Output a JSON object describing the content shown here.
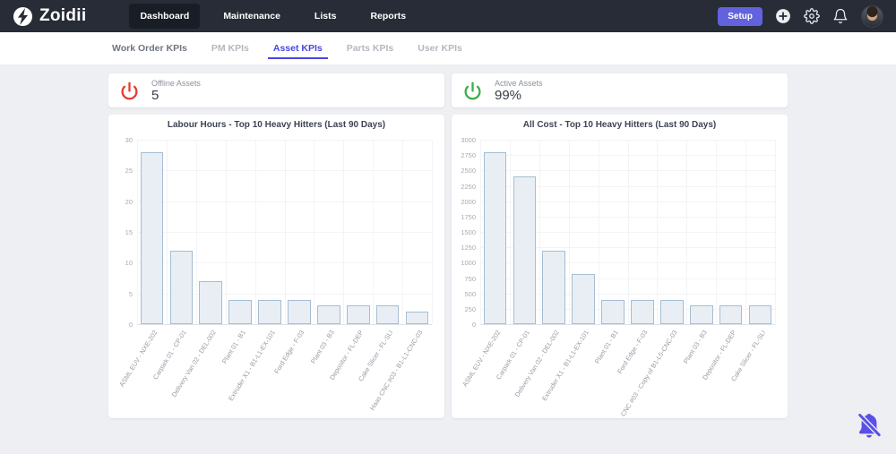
{
  "navbar": {
    "brand": "Zoidii",
    "items": [
      {
        "label": "Dashboard",
        "active": true
      },
      {
        "label": "Maintenance",
        "active": false
      },
      {
        "label": "Lists",
        "active": false
      },
      {
        "label": "Reports",
        "active": false
      }
    ],
    "setup_label": "Setup",
    "icons": {
      "brand": "bolt-circle-icon",
      "add": "plus-circle-icon",
      "settings": "gear-icon",
      "notifications": "bell-icon",
      "avatar": "user-avatar"
    }
  },
  "tabs": [
    {
      "label": "Work Order KPIs",
      "active": false
    },
    {
      "label": "PM KPIs",
      "active": false
    },
    {
      "label": "Asset KPIs",
      "active": true
    },
    {
      "label": "Parts KPIs",
      "active": false
    },
    {
      "label": "User KPIs",
      "active": false
    }
  ],
  "kpis": [
    {
      "label": "Offline Assets",
      "value": "5",
      "icon": "power-icon",
      "color": "#e23b30"
    },
    {
      "label": "Active Assets",
      "value": "99%",
      "icon": "power-icon",
      "color": "#3aae46"
    }
  ],
  "chart_data": [
    {
      "type": "bar",
      "title": "Labour Hours - Top 10 Heavy Hitters (Last 90 Days)",
      "categories": [
        "ASML EUV - NXE-202",
        "Carpark 01 - CP-01",
        "Delivery Van 02 - DEL-002",
        "Plant 01 - B1",
        "Extruder X1 - B1-L1-EX-101",
        "Ford Edge - F-03",
        "Plant 03 - B3",
        "Depositor - FL-DEP",
        "Cake Slicer - FL-SLI",
        "Haas CNC #03 - B1-L1-CNC-03"
      ],
      "values": [
        28,
        12,
        7,
        4,
        4,
        4,
        3,
        3,
        3,
        2
      ],
      "xlabel": "",
      "ylabel": "",
      "ylim": [
        0,
        30
      ],
      "ytick_step": 5,
      "grid": true,
      "legend": "none",
      "bar_fill": "#e9eef4",
      "bar_border": "#a5bed3"
    },
    {
      "type": "bar",
      "title": "All Cost - Top 10 Heavy Hitters (Last 90 Days)",
      "categories": [
        "ASML EUV - NXE-202",
        "Carpark 01 - CP-01",
        "Delivery Van 02 - DEL-002",
        "Extruder X1 - B1-L1-EX-101",
        "Plant 01 - B1",
        "Ford Edge - F-03",
        "Haas CNC #03 - Copy of B1-L5-CNC-03",
        "Plant 03 - B3",
        "Depositor - FL-DEP",
        "Cake Slicer - FL-SLI"
      ],
      "values": [
        2800,
        2400,
        1200,
        810,
        390,
        390,
        390,
        300,
        300,
        300
      ],
      "xlabel": "",
      "ylabel": "",
      "ylim": [
        0,
        3000
      ],
      "ytick_step": 250,
      "grid": true,
      "legend": "none",
      "bar_fill": "#e9eef4",
      "bar_border": "#a5bed3"
    }
  ],
  "floating_icon": {
    "name": "bell-off-icon",
    "color": "#5a50e6"
  },
  "colors": {
    "accent": "#4a45e4",
    "setup_button": "#6262de",
    "navbar_bg": "#272c36"
  }
}
